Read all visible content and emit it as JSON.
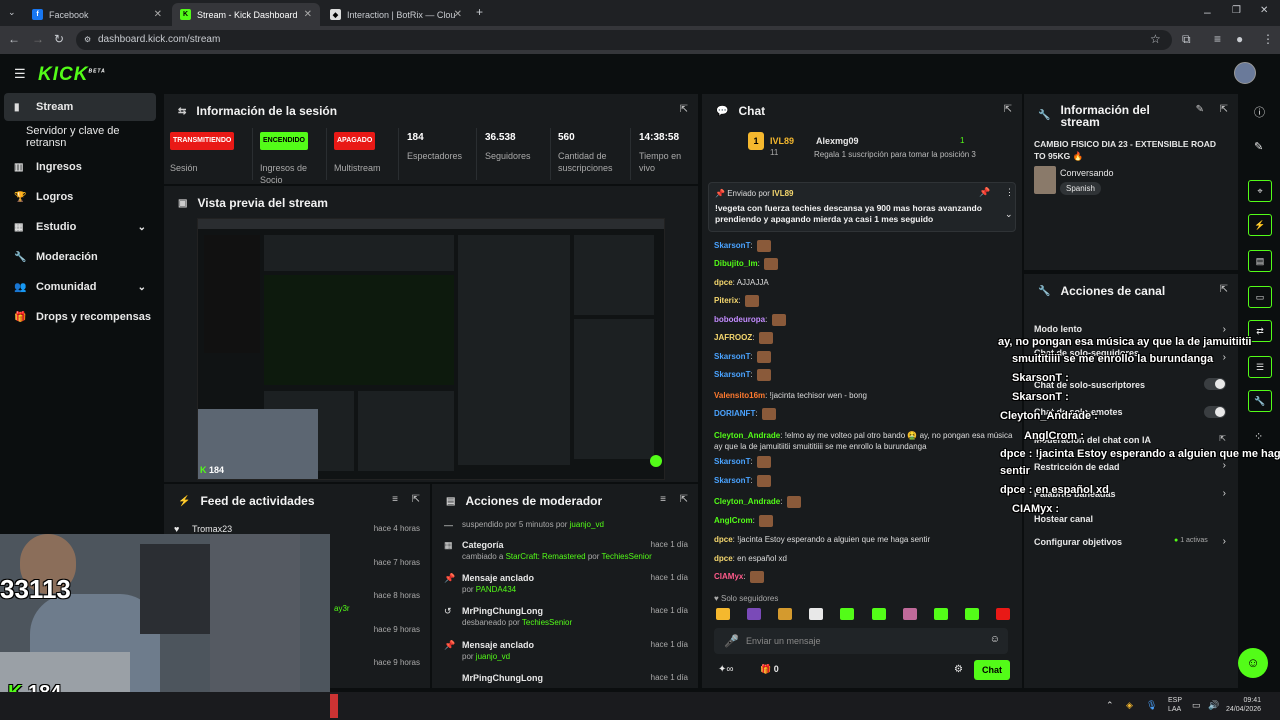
{
  "browser": {
    "tabs": [
      {
        "label": "Facebook",
        "icon": "facebook-icon"
      },
      {
        "label": "Stream - Kick Dashboard",
        "icon": "kick-icon"
      },
      {
        "label": "Interaction | BotRix — Clou",
        "icon": "botrix-icon"
      }
    ],
    "url": "dashboard.kick.com/stream"
  },
  "header": {
    "logo": "KICK",
    "logo_badge": "BETA"
  },
  "sidebar": {
    "items": [
      {
        "label": "Stream",
        "icon": "stream-icon"
      },
      {
        "label": "Servidor y clave de retransn",
        "icon": ""
      },
      {
        "label": "Ingresos",
        "icon": "chart-icon"
      },
      {
        "label": "Logros",
        "icon": "trophy-icon"
      },
      {
        "label": "Estudio",
        "icon": "studio-icon"
      },
      {
        "label": "Moderación",
        "icon": "wrench-icon"
      },
      {
        "label": "Comunidad",
        "icon": "community-icon"
      },
      {
        "label": "Drops y recompensas",
        "icon": "gift-icon"
      }
    ]
  },
  "session": {
    "title": "Información de la sesión",
    "badges": [
      {
        "text": "TRANSMITIENDO",
        "label": "Sesión",
        "color": "#e91916"
      },
      {
        "text": "ENCENDIDO",
        "label": "Ingresos de Socio",
        "color": "#53fc18"
      },
      {
        "text": "APAGADO",
        "label": "Multistream",
        "color": "#e91916"
      }
    ],
    "stats": [
      {
        "value": "184",
        "label": "Espectadores"
      },
      {
        "value": "36.538",
        "label": "Seguidores"
      },
      {
        "value": "560",
        "label": "Cantidad de suscripciones"
      },
      {
        "value": "14:38:58",
        "label": "Tiempo en vivo"
      }
    ]
  },
  "preview": {
    "title": "Vista previa del stream",
    "viewer_count": "184"
  },
  "feed": {
    "title": "Feed de actividades",
    "rows": [
      {
        "user": "Tromax23",
        "time": "hace 4 horas"
      },
      {
        "user": "",
        "time": "hace 7 horas"
      },
      {
        "user": "",
        "time": "hace 8 horas"
      },
      {
        "user": "",
        "time": "hace 9 horas"
      },
      {
        "user": "",
        "time": "hace 9 horas"
      }
    ],
    "partial_name": "ay3r"
  },
  "mod": {
    "title": "Acciones de moderador",
    "top_line": "suspendido por 5 minutos por",
    "top_user": "juanjo_vd",
    "rows": [
      {
        "title": "Categoría",
        "detail": "cambiado a",
        "target": "StarCraft: Remastered",
        "by": "por",
        "user": "TechiesSenior",
        "time": "hace 1 día"
      },
      {
        "title": "Mensaje anclado",
        "detail": "por",
        "target": "",
        "by": "",
        "user": "PANDA434",
        "time": "hace 1 día"
      },
      {
        "title": "MrPingChungLong",
        "detail": "desbaneado por",
        "target": "",
        "by": "",
        "user": "TechiesSenior",
        "time": "hace 1 día"
      },
      {
        "title": "Mensaje anclado",
        "detail": "por",
        "target": "",
        "by": "",
        "user": "juanjo_vd",
        "time": "hace 1 día"
      },
      {
        "title": "MrPingChungLong",
        "detail": "",
        "target": "",
        "by": "",
        "user": "",
        "time": "hace 1 día"
      }
    ]
  },
  "chat": {
    "title": "Chat",
    "leader": {
      "rank": "1",
      "name": "IVL89",
      "count": "11",
      "user": "Alexmg09",
      "value": "1",
      "text": "Regala 1 suscripción para tomar la posición 3"
    },
    "pinned": {
      "label": "Enviado por",
      "user": "IVL89",
      "text": "!vegeta con fuerza techies descansa ya 900 mas horas avanzando prendiendo y apagando mierda ya casi 1 mes seguido"
    },
    "messages": [
      {
        "user": "SkarsonT",
        "text": "",
        "color": "#4aa3ff"
      },
      {
        "user": "Dibujito_lm",
        "text": "",
        "color": "#53fc18"
      },
      {
        "user": "dpce",
        "text": "AJJAJJA",
        "color": "#f5d76e"
      },
      {
        "user": "Piterix",
        "text": "",
        "color": "#f5d76e"
      },
      {
        "user": "bobodeuropa",
        "text": "",
        "color": "#c38bff"
      },
      {
        "user": "JAFROOZ",
        "text": "",
        "color": "#f5d76e"
      },
      {
        "user": "SkarsonT",
        "text": "",
        "color": "#4aa3ff"
      },
      {
        "user": "SkarsonT",
        "text": "",
        "color": "#4aa3ff"
      },
      {
        "user": "Valensito16m",
        "text": "!jacinta techisor wen - bong",
        "color": "#ff7a2f"
      },
      {
        "user": "DORIANFT",
        "text": "",
        "color": "#4aa3ff"
      },
      {
        "user": "Cleyton_Andrade",
        "text": "!elmo ay me volteo pal otro bando 🤮 ay, no pongan esa música ay que la de jamuitiitii smuititiiii se me enrollo la burundanga",
        "color": "#53fc18"
      },
      {
        "user": "SkarsonT",
        "text": "",
        "color": "#4aa3ff"
      },
      {
        "user": "SkarsonT",
        "text": "",
        "color": "#4aa3ff"
      },
      {
        "user": "Cleyton_Andrade",
        "text": "",
        "color": "#53fc18"
      },
      {
        "user": "AnglCrom",
        "text": "",
        "color": "#53fc18"
      },
      {
        "user": "dpce",
        "text": "!jacinta Estoy esperando a alguien que me haga sentir",
        "color": "#f5d76e"
      },
      {
        "user": "dpce",
        "text": "en español xd",
        "color": "#f5d76e"
      },
      {
        "user": "CIAMyx",
        "text": "",
        "color": "#ff5a8a"
      }
    ],
    "mode": "Solo seguidores",
    "input_placeholder": "Enviar un mensaje",
    "count": "0",
    "send": "Chat"
  },
  "stream_info": {
    "title": "Información del stream",
    "stream_title": "CAMBIO FISICO DIA 23 - EXTENSIBLE ROAD TO 95KG 🔥",
    "category": "Conversando",
    "language": "Spanish"
  },
  "channel": {
    "title": "Acciones de canal",
    "rows": [
      {
        "label": "Modo lento"
      },
      {
        "label": "Chat de solo-seguidores"
      },
      {
        "label": "Chat de solo-suscriptores"
      },
      {
        "label": "Chat de solo-emotes"
      },
      {
        "label": "Moderación del chat con IA"
      },
      {
        "label": "Restricción de edad"
      },
      {
        "label": "Palabras baneadas"
      },
      {
        "label": "Hostear canal"
      },
      {
        "label": "Configurar objetivos",
        "extra": "1 activas"
      }
    ]
  },
  "overlay": {
    "lines": [
      "ay, no pongan esa música ay que la de jamuitiitii",
      "smuititiiii se me enrollo la burundanga",
      "SkarsonT :",
      "SkarsonT :",
      "Cleyton_Andrade :",
      "AnglCrom :",
      "dpce : !jacinta Estoy esperando a alguien que me haga",
      "sentir",
      "dpce : en español xd",
      "CIAMyx :"
    ],
    "webcam_number": "33113",
    "viewer_count": "184"
  },
  "taskbar": {
    "lang1": "ESP",
    "lang2": "LAA",
    "time": "09:41",
    "date": "24/04/2026"
  }
}
